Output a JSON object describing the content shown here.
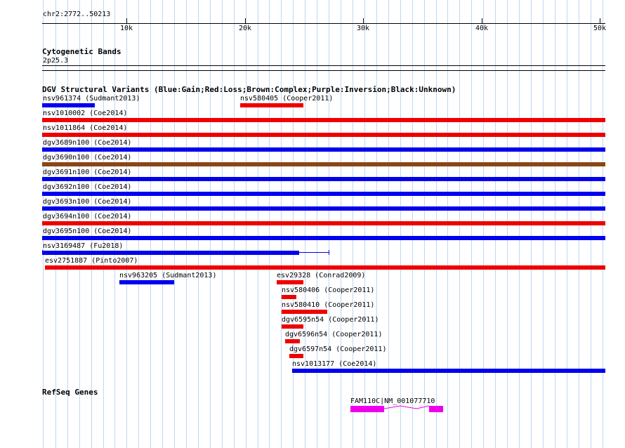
{
  "ruler": {
    "position": "chr2:2772..50213",
    "ticks": [
      "10k",
      "20k",
      "30k",
      "40k",
      "50k"
    ]
  },
  "cytoband": {
    "title": "Cytogenetic Bands",
    "band": "2p25.3"
  },
  "dgv": {
    "title": "DGV Structural Variants (Blue:Gain;Red:Loss;Brown:Complex;Purple:Inversion;Black:Unknown)",
    "colors": {
      "gain": "#0000ee",
      "loss": "#ee0000",
      "complex": "#8b4513"
    },
    "variants": [
      {
        "label": "nsv961374 (Sudmant2013)",
        "type": "gain"
      },
      {
        "label": "nsv580405 (Cooper2011)",
        "type": "loss"
      },
      {
        "label": "nsv1010002 (Coe2014)",
        "type": "loss"
      },
      {
        "label": "nsv1011864 (Coe2014)",
        "type": "loss"
      },
      {
        "label": "dgv3689n100 (Coe2014)",
        "type": "gain"
      },
      {
        "label": "dgv3690n100 (Coe2014)",
        "type": "complex"
      },
      {
        "label": "dgv3691n100 (Coe2014)",
        "type": "gain"
      },
      {
        "label": "dgv3692n100 (Coe2014)",
        "type": "gain"
      },
      {
        "label": "dgv3693n100 (Coe2014)",
        "type": "gain"
      },
      {
        "label": "dgv3694n100 (Coe2014)",
        "type": "loss"
      },
      {
        "label": "dgv3695n100 (Coe2014)",
        "type": "gain"
      },
      {
        "label": "nsv3169487 (Fu2018)",
        "type": "gain"
      },
      {
        "label": "esv2751887 (Pinto2007)",
        "type": "loss"
      },
      {
        "label": "nsv963205 (Sudmant2013)",
        "type": "gain"
      },
      {
        "label": "esv29328 (Conrad2009)",
        "type": "loss"
      },
      {
        "label": "nsv580406 (Cooper2011)",
        "type": "loss"
      },
      {
        "label": "nsv580410 (Cooper2011)",
        "type": "loss"
      },
      {
        "label": "dgv6595n54 (Cooper2011)",
        "type": "loss"
      },
      {
        "label": "dgv6596n54 (Cooper2011)",
        "type": "loss"
      },
      {
        "label": "dgv6597n54 (Cooper2011)",
        "type": "loss"
      },
      {
        "label": "nsv1013177 (Coe2014)",
        "type": "gain"
      }
    ]
  },
  "refseq": {
    "title": "RefSeq Genes",
    "gene_label": "FAM110C|NM_001077710",
    "color": "#ee00ee"
  }
}
